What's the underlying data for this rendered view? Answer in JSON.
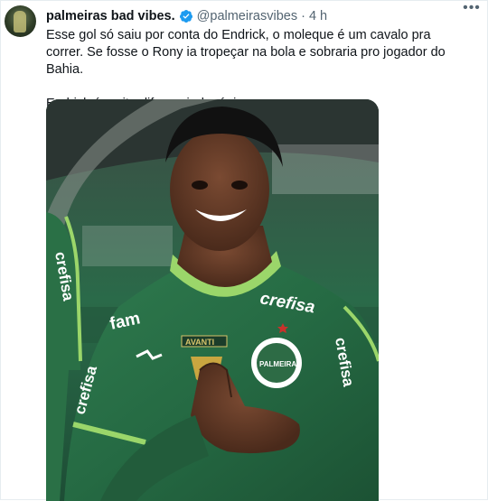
{
  "author": {
    "name": "palmeiras bad vibes.",
    "handle": "@palmeirasvibes",
    "separator": "·",
    "time": "4 h"
  },
  "tweet": {
    "lines": [
      "Esse gol só saiu por conta do Endrick, o moleque é um cavalo pra correr. Se fosse o Rony ia tropeçar na bola e sobraria pro jogador do Bahia.",
      "Endrick é muito diferenciado, único."
    ]
  },
  "media": {
    "sponsor_chest": "crefisa",
    "sponsor_sleeve": "crefisa",
    "kit_brand": "fam",
    "badge_text": "PALMEIRAS",
    "patch_text": "AVANTI",
    "left_sponsor": "crefisa"
  },
  "icons": {
    "more": "more-horizontal-icon",
    "verified": "verified-badge-icon"
  },
  "colors": {
    "verified": "#1d9bf0",
    "kit_green": "#2d6b45",
    "kit_lime": "#9bd66a"
  }
}
